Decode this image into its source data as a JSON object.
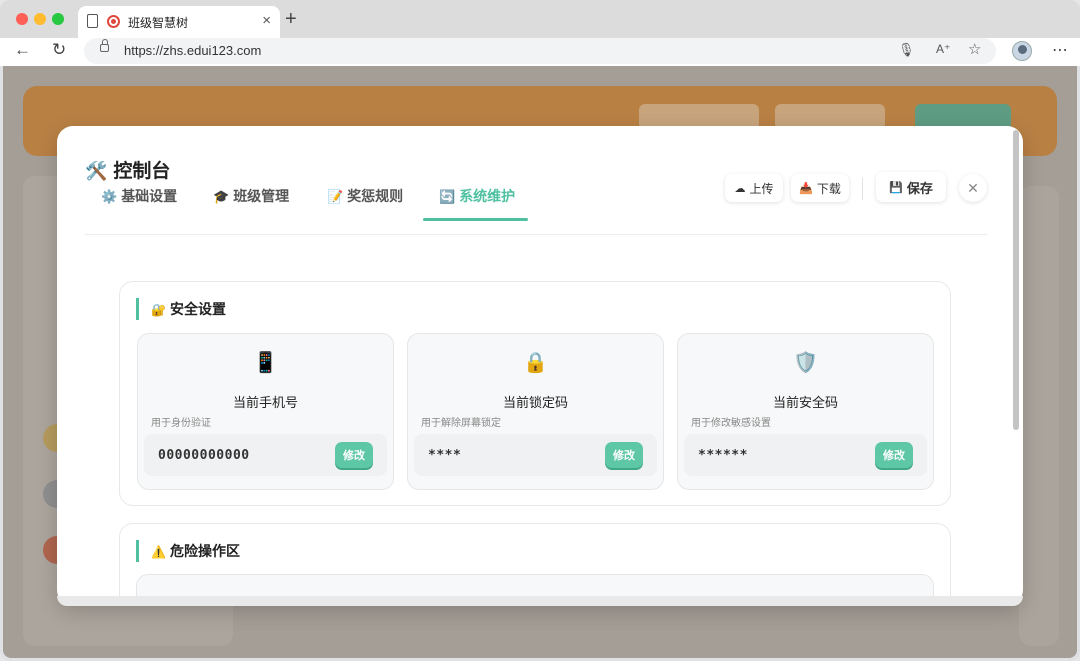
{
  "browser": {
    "tab_title": "班级智慧树",
    "tab_close": "×",
    "new_tab": "+",
    "url": "https://zhs.edui123.com",
    "icons": [
      "back-icon",
      "reload-icon",
      "lock-icon",
      "mic-icon",
      "read-aloud-icon",
      "favorite-icon",
      "profile-avatar",
      "more-icon"
    ]
  },
  "modal": {
    "title_icon": "🛠️",
    "title": "控制台",
    "tabs": [
      {
        "icon": "⚙️",
        "label": "基础设置",
        "active": false
      },
      {
        "icon": "🎓",
        "label": "班级管理",
        "active": false
      },
      {
        "icon": "📝",
        "label": "奖惩规则",
        "active": false
      },
      {
        "icon": "🔄",
        "label": "系统维护",
        "active": true
      }
    ],
    "actions": {
      "upload_icon": "☁",
      "upload": "上传",
      "download_icon": "📥",
      "download": "下载",
      "save_icon": "💾",
      "save": "保存",
      "close": "✕"
    },
    "security": {
      "icon": "🔐",
      "title": "安全设置",
      "cards": [
        {
          "icon": "📱",
          "title": "当前手机号",
          "desc": "用于身份验证",
          "value": "00000000000",
          "button": "修改"
        },
        {
          "icon": "🔒",
          "title": "当前锁定码",
          "desc": "用于解除屏幕锁定",
          "value": "****",
          "button": "修改"
        },
        {
          "icon": "🛡️",
          "title": "当前安全码",
          "desc": "用于修改敏感设置",
          "value": "******",
          "button": "修改"
        }
      ]
    },
    "danger": {
      "icon": "⚠️",
      "title": "危险操作区"
    }
  },
  "colors": {
    "accent": "#4fc1a1",
    "button": "#5ec7a5",
    "backdrop": "#a49e96",
    "bg_header": "#b98044"
  }
}
